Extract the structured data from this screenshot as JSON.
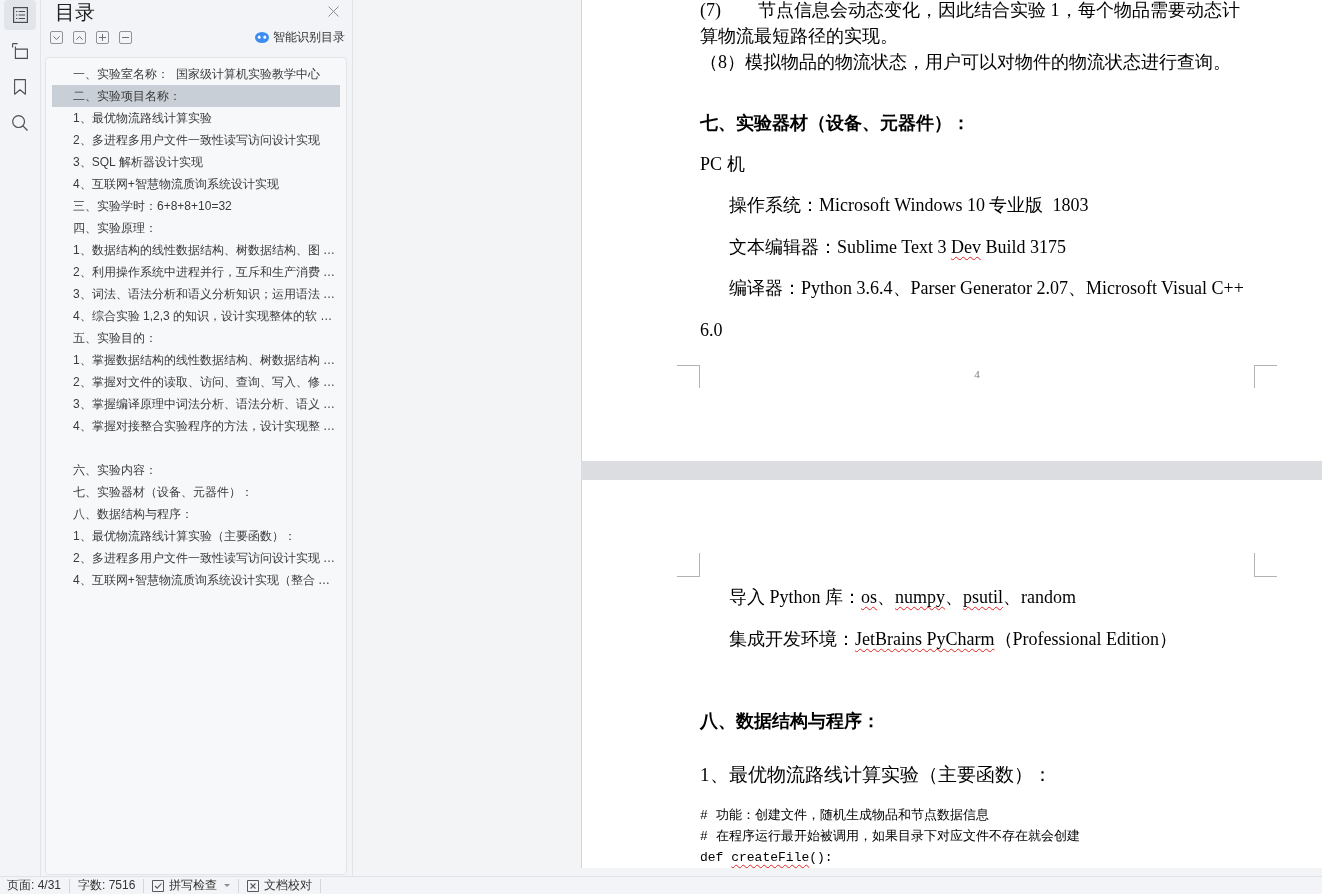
{
  "rail_tabs": [
    {
      "kind": "contents",
      "selected": true
    },
    {
      "kind": "outline",
      "selected": false
    },
    {
      "kind": "bookmarks",
      "selected": false
    },
    {
      "kind": "search",
      "selected": false
    }
  ],
  "panel": {
    "title": "目录",
    "smart_button": "智能识别目录",
    "toc_groups": [
      {
        "items": [
          {
            "label": "一、实验室名称：  国家级计算机实验教学中心",
            "selected": false
          },
          {
            "label": "二、实验项目名称：",
            "selected": true
          },
          {
            "label": "1、最优物流路线计算实验",
            "selected": false
          },
          {
            "label": "2、多进程多用户文件一致性读写访问设计实现",
            "selected": false
          },
          {
            "label": "3、SQL 解析器设计实现",
            "selected": false
          },
          {
            "label": "4、互联网+智慧物流质询系统设计实现",
            "selected": false
          },
          {
            "label": "三、实验学时：6+8+8+10=32",
            "selected": false
          },
          {
            "label": "四、实验原理：",
            "selected": false
          },
          {
            "label": "1、数据结构的线性数据结构、树数据结构、图 …",
            "selected": false
          },
          {
            "label": "2、利用操作系统中进程并行，互斥和生产消费 …",
            "selected": false
          },
          {
            "label": "3、词法、语法分析和语义分析知识；运用语法 …",
            "selected": false
          },
          {
            "label": "4、综合实验 1,2,3 的知识，设计实现整体的软 …",
            "selected": false
          },
          {
            "label": "五、实验目的：",
            "selected": false
          },
          {
            "label": "1、掌握数据结构的线性数据结构、树数据结构 …",
            "selected": false
          },
          {
            "label": "2、掌握对文件的读取、访问、查询、写入、修 …",
            "selected": false
          },
          {
            "label": "3、掌握编译原理中词法分析、语法分析、语义 …",
            "selected": false
          },
          {
            "label": "4、掌握对接整合实验程序的方法，设计实现整 …",
            "selected": false
          }
        ]
      },
      {
        "items": [
          {
            "label": "六、实验内容：",
            "selected": false
          },
          {
            "label": "七、实验器材（设备、元器件）：",
            "selected": false
          },
          {
            "label": "八、数据结构与程序：",
            "selected": false
          },
          {
            "label": "1、最优物流路线计算实验（主要函数）：",
            "selected": false
          },
          {
            "label": "2、多进程多用户文件一致性读写访问设计实现 …",
            "selected": false
          },
          {
            "label": "4、互联网+智慧物流质询系统设计实现（整合 …",
            "selected": false
          }
        ]
      }
    ]
  },
  "pages": [
    {
      "page_number": "4",
      "paragraphs": [
        {
          "kind": "list",
          "segments": [
            {
              "text": "(7)\t节点信息会动态变化，因此结合实验 1，每个物品需要动态计算物流最短路径的实现。",
              "flagged": false
            }
          ]
        },
        {
          "kind": "list",
          "segments": [
            {
              "text": "（8）模拟物品的物流状态，用户可以对物件的物流状态进行查询。",
              "flagged": false
            }
          ]
        },
        {
          "kind": "heading",
          "segments": [
            {
              "text": "七、实验器材（设备、元器件）：",
              "flagged": false
            }
          ]
        },
        {
          "kind": "body",
          "segments": [
            {
              "text": "PC 机",
              "flagged": false
            }
          ]
        },
        {
          "kind": "indent",
          "segments": [
            {
              "text": "操作系统：Microsoft Windows 10 专业版  1803",
              "flagged": false
            }
          ]
        },
        {
          "kind": "indent",
          "segments": [
            {
              "text": "文本编辑器：Sublime Text 3 ",
              "flagged": false
            },
            {
              "text": "Dev",
              "flagged": true
            },
            {
              "text": " Build 3175",
              "flagged": false
            }
          ]
        },
        {
          "kind": "indent",
          "segments": [
            {
              "text": "编译器：Python 3.6.4、Parser Generator 2.07、Microsoft Visual C++\n6.0",
              "flagged": false
            }
          ]
        }
      ]
    },
    {
      "paragraphs": [
        {
          "kind": "indent",
          "segments": [
            {
              "text": "导入 Python 库：",
              "flagged": false
            },
            {
              "text": "os",
              "flagged": true
            },
            {
              "text": "、",
              "flagged": false
            },
            {
              "text": "numpy",
              "flagged": true
            },
            {
              "text": "、",
              "flagged": false
            },
            {
              "text": "psutil",
              "flagged": true
            },
            {
              "text": "、random",
              "flagged": false
            }
          ]
        },
        {
          "kind": "indent",
          "segments": [
            {
              "text": "集成开发环境：",
              "flagged": false
            },
            {
              "text": "JetBrains PyCharm",
              "flagged": true
            },
            {
              "text": "（Professional Edition）",
              "flagged": false
            }
          ]
        },
        {
          "kind": "heading",
          "segments": [
            {
              "text": "八、数据结构与程序：",
              "flagged": false
            }
          ]
        },
        {
          "kind": "subheading",
          "segments": [
            {
              "text": "1、最优物流路线计算实验（主要函数）：",
              "flagged": false
            }
          ]
        },
        {
          "kind": "code",
          "segments": [
            {
              "text": "# 功能：创建文件，随机生成物品和节点数据信息",
              "flagged": false
            }
          ]
        },
        {
          "kind": "code",
          "segments": [
            {
              "text": "# 在程序运行最开始被调用，如果目录下对应文件不存在就会创建",
              "flagged": false
            }
          ]
        },
        {
          "kind": "code",
          "segments": [
            {
              "text": "def ",
              "flagged": false
            },
            {
              "text": "createFile",
              "flagged": true
            },
            {
              "text": "():",
              "flagged": false
            }
          ]
        }
      ]
    }
  ],
  "status_bar": {
    "page": "页面: 4/31",
    "word_count": "字数: 7516",
    "spell_check": "拼写检查",
    "proofread": "文档校对"
  }
}
